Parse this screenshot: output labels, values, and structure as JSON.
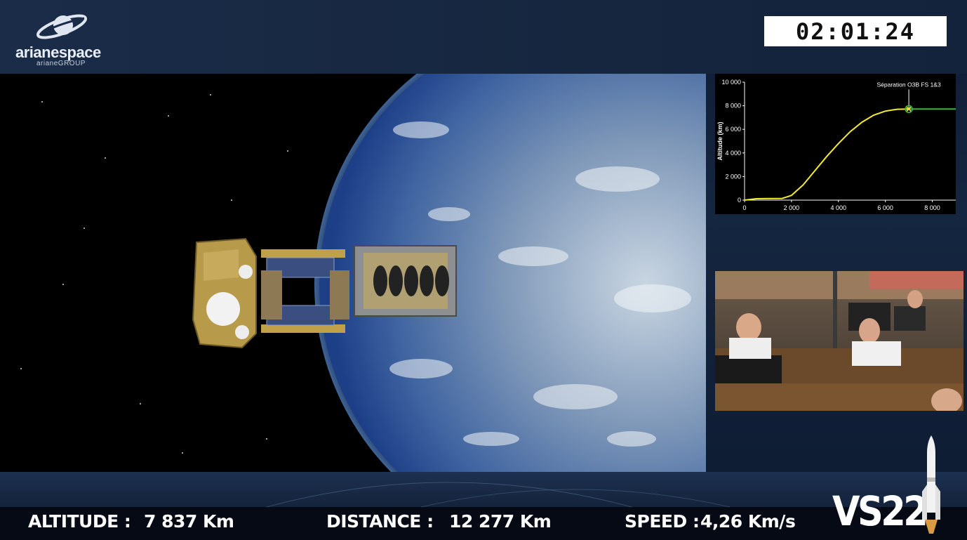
{
  "brand": {
    "name": "arianespace",
    "group": "arianeGROUP"
  },
  "timer": {
    "value": "02:01:24"
  },
  "graph": {
    "event_label": "Séparation O3B FS 1&3",
    "colors": {
      "trajectory": "#f2ec2c",
      "after_separation": "#3cb43c",
      "axes": "#ffffff"
    }
  },
  "chart_data": {
    "type": "line",
    "title": "",
    "xlabel": "",
    "ylabel": "Altitude (km)",
    "xlim": [
      0,
      9000
    ],
    "ylim": [
      0,
      10000
    ],
    "x_ticks": [
      "0",
      "2 000",
      "4 000",
      "6 000",
      "8 000"
    ],
    "y_ticks": [
      "0",
      "2 000",
      "4 000",
      "6 000",
      "8 000",
      "10 000"
    ],
    "series": [
      {
        "points": [
          [
            0,
            0
          ],
          [
            500,
            120
          ],
          [
            1000,
            130
          ],
          [
            1600,
            140
          ],
          [
            2000,
            400
          ],
          [
            2500,
            1300
          ],
          [
            3000,
            2500
          ],
          [
            3500,
            3700
          ],
          [
            4000,
            4800
          ],
          [
            4500,
            5800
          ],
          [
            5000,
            6600
          ],
          [
            5500,
            7200
          ],
          [
            6000,
            7550
          ],
          [
            6500,
            7700
          ],
          [
            7000,
            7720
          ]
        ]
      },
      {
        "points": [
          [
            7000,
            7720
          ],
          [
            9000,
            7720
          ]
        ]
      }
    ],
    "annotations": [
      {
        "x": 7000,
        "y": 7720,
        "text": "Séparation O3B FS 1&3"
      }
    ]
  },
  "telemetry": {
    "altitude_label": "ALTITUDE :",
    "altitude_value": "7 837 Km",
    "distance_label": "DISTANCE :",
    "distance_value": "12 277 Km",
    "speed_label": "SPEED :",
    "speed_value": "4,26 Km/s"
  },
  "mission": {
    "code": "VS22"
  }
}
